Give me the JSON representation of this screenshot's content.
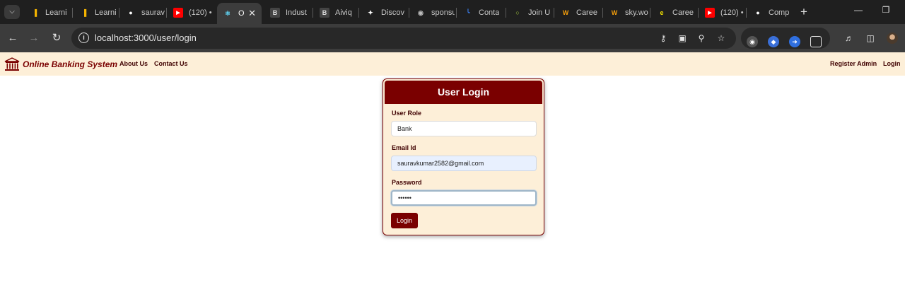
{
  "browser": {
    "tabs": [
      {
        "title": "Learni",
        "icon": "bar-chart-favicon-icon",
        "color": "#f5b400"
      },
      {
        "title": "Learni",
        "icon": "bar-chart-favicon-icon",
        "color": "#f5b400"
      },
      {
        "title": "saurav",
        "icon": "github-icon",
        "color": "#ffffff"
      },
      {
        "title": "(120) •",
        "icon": "youtube-icon",
        "color": "#ff0000"
      },
      {
        "title": "O",
        "icon": "react-icon",
        "color": "#61dafb",
        "active": true
      },
      {
        "title": "Indust",
        "icon": "b-letter-icon",
        "color": "#444444"
      },
      {
        "title": "Aiviq",
        "icon": "b-letter-icon",
        "color": "#444444"
      },
      {
        "title": "Discov",
        "icon": "discord-like-icon",
        "color": "#ffffff"
      },
      {
        "title": "sponsu",
        "icon": "circle-logo-icon",
        "color": "#bbbbbb"
      },
      {
        "title": "Conta",
        "icon": "hook-logo-icon",
        "color": "#3b82f6"
      },
      {
        "title": "Join U",
        "icon": "ring-logo-icon",
        "color": "#a3c940"
      },
      {
        "title": "Caree",
        "icon": "w-logo-icon",
        "color": "#f59e0b"
      },
      {
        "title": "sky.wo",
        "icon": "w-logo-icon",
        "color": "#f59e0b"
      },
      {
        "title": "Caree",
        "icon": "e-logo-icon",
        "color": "#f5e400"
      },
      {
        "title": "(120) •",
        "icon": "youtube-icon",
        "color": "#ff0000"
      },
      {
        "title": "Comp",
        "icon": "github-icon",
        "color": "#ffffff"
      }
    ],
    "new_tab_symbol": "+",
    "address": "localhost:3000/user/login"
  },
  "site": {
    "brand": "Online Banking System",
    "nav_left": [
      "About Us",
      "Contact Us"
    ],
    "nav_right": [
      "Register Admin",
      "Login"
    ],
    "brand_color": "#7a0000",
    "nav_bg": "#fdefd8"
  },
  "login_form": {
    "title": "User Login",
    "role_label": "User Role",
    "role_value": "Bank",
    "email_label": "Email Id",
    "email_value": "sauravkumar2582@gmail.com",
    "password_label": "Password",
    "password_value": "••••••",
    "submit_label": "Login"
  }
}
